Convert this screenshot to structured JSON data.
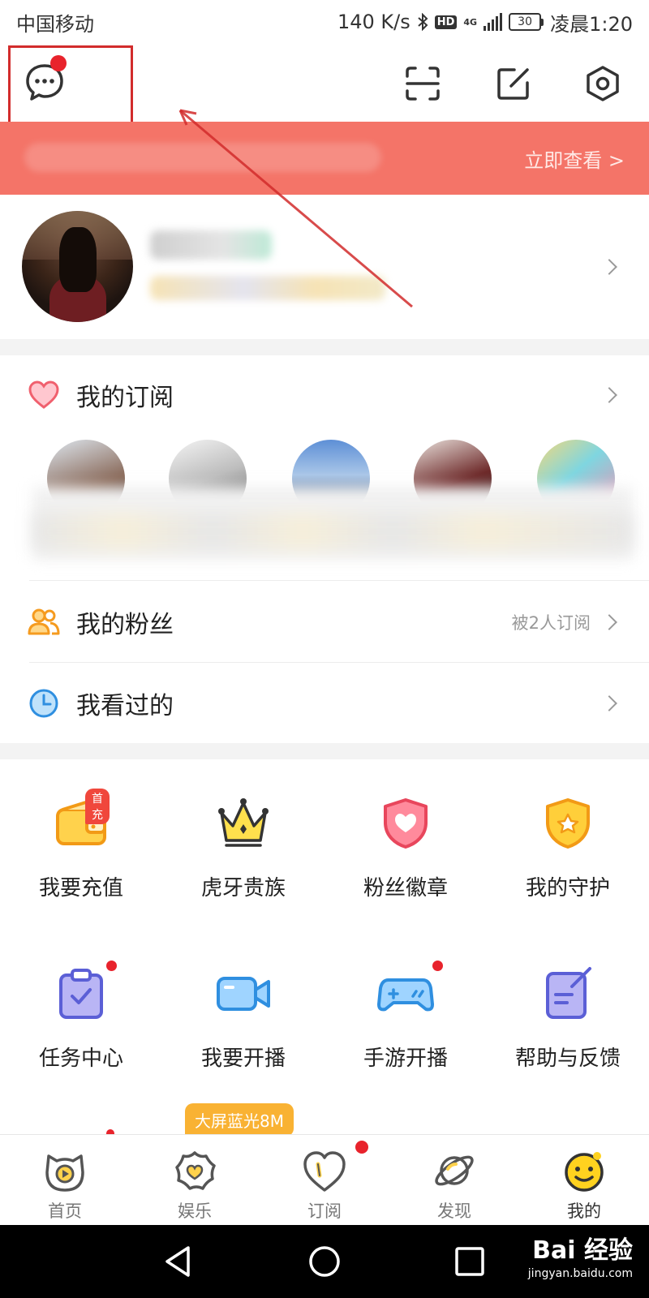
{
  "status_bar": {
    "carrier": "中国移动",
    "speed": "140 K/s",
    "hd": "HD",
    "network": "4G",
    "battery": "30",
    "time": "凌晨1:20"
  },
  "top_bar": {
    "icons": [
      "message-icon",
      "scan-icon",
      "edit-icon",
      "settings-icon"
    ]
  },
  "banner": {
    "cta": "立即查看 >"
  },
  "subscriptions": {
    "label": "我的订阅"
  },
  "menu_rows": [
    {
      "label": "我的粉丝",
      "extra": "被2人订阅"
    },
    {
      "label": "我看过的",
      "extra": ""
    }
  ],
  "grid": [
    {
      "label": "我要充值",
      "badge": "首充"
    },
    {
      "label": "虎牙贵族"
    },
    {
      "label": "粉丝徽章"
    },
    {
      "label": "我的守护"
    },
    {
      "label": "任务中心"
    },
    {
      "label": "我要开播"
    },
    {
      "label": "手游开播"
    },
    {
      "label": "帮助与反馈"
    }
  ],
  "promo": "大屏蓝光8M",
  "tabs": [
    {
      "label": "首页"
    },
    {
      "label": "娱乐"
    },
    {
      "label": "订阅"
    },
    {
      "label": "发现"
    },
    {
      "label": "我的"
    }
  ],
  "watermark": {
    "brand": "Bai 经验",
    "url": "jingyan.baidu.com"
  },
  "colors": {
    "banner": "#f47468",
    "badge_red": "#e8232c",
    "accent_yellow": "#f9b233"
  }
}
